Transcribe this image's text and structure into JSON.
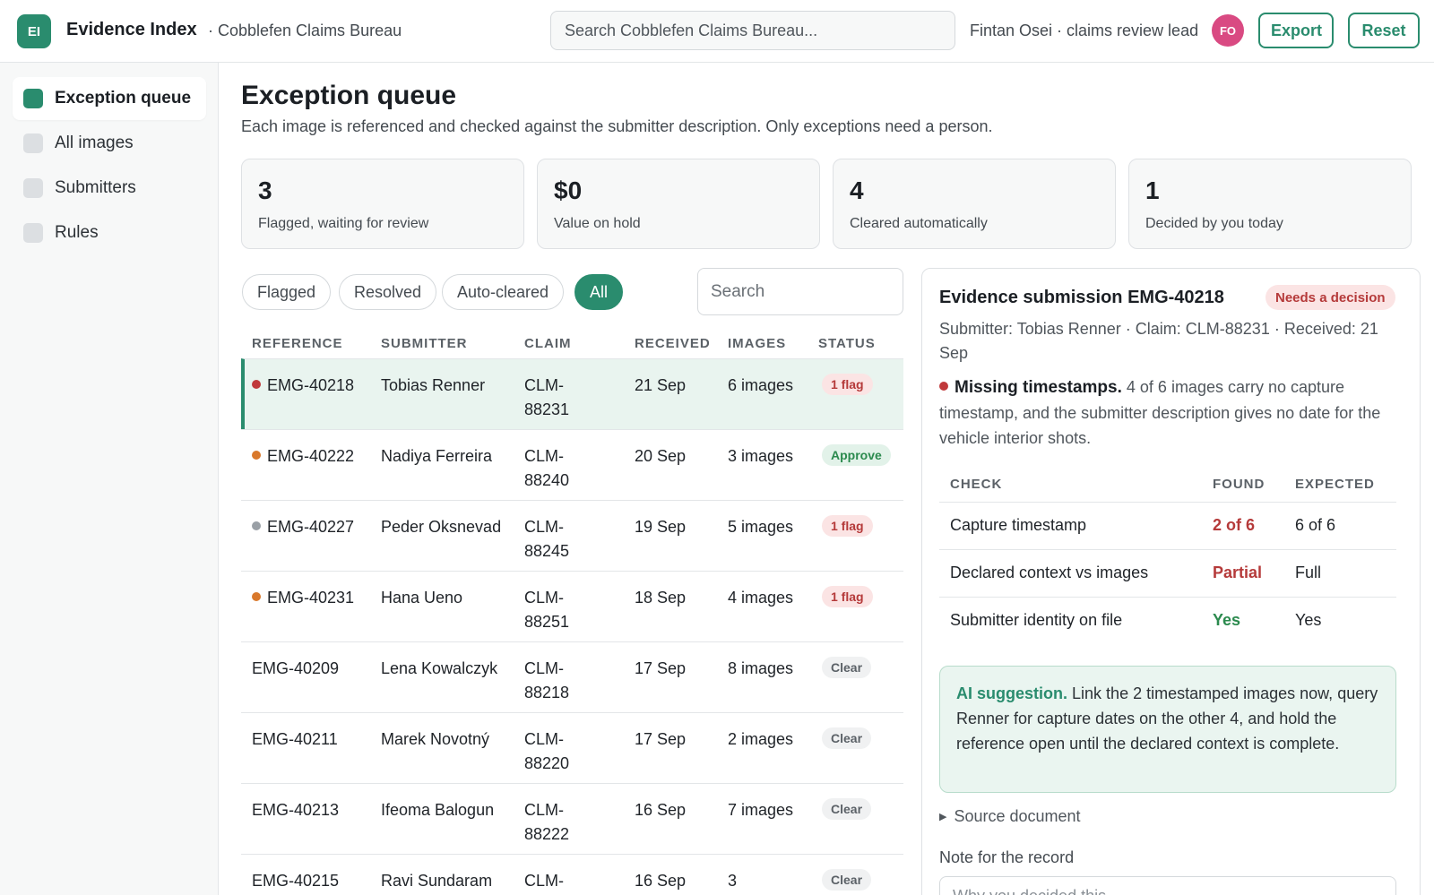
{
  "app": {
    "logo_text": "EI",
    "title": "Evidence Index",
    "org": "· Cobblefen Claims Bureau",
    "search_placeholder": "Search Cobblefen Claims Bureau...",
    "user": "Fintan Osei · claims review lead",
    "avatar": "FO",
    "export_label": "Export",
    "reset_label": "Reset"
  },
  "sidebar": {
    "items": [
      {
        "label": "Exception queue",
        "active": true
      },
      {
        "label": "All images",
        "active": false
      },
      {
        "label": "Submitters",
        "active": false
      },
      {
        "label": "Rules",
        "active": false
      }
    ]
  },
  "page": {
    "title": "Exception queue",
    "subtitle": "Each image is referenced and checked against the submitter description. Only exceptions need a person."
  },
  "stats": [
    {
      "value": "3",
      "label": "Flagged, waiting for review"
    },
    {
      "value": "$0",
      "label": "Value on hold"
    },
    {
      "value": "4",
      "label": "Cleared automatically"
    },
    {
      "value": "1",
      "label": "Decided by you today"
    }
  ],
  "filters": [
    "Flagged",
    "Resolved",
    "Auto-cleared",
    "All"
  ],
  "active_filter": "All",
  "table_search_placeholder": "Search",
  "table": {
    "headers": [
      "REFERENCE",
      "SUBMITTER",
      "CLAIM",
      "RECEIVED",
      "IMAGES",
      "STATUS"
    ],
    "rows": [
      {
        "ref": "EMG-40218",
        "submitter": "Tobias Renner",
        "claim": "CLM-88231",
        "received": "21 Sep",
        "images": "6 images",
        "status": "1 flag",
        "kind": "flag",
        "dot": "#c0393b",
        "selected": true
      },
      {
        "ref": "EMG-40222",
        "submitter": "Nadiya Ferreira",
        "claim": "CLM-88240",
        "received": "20 Sep",
        "images": "3 images",
        "status": "Approve",
        "kind": "approve",
        "dot": "#d9782b",
        "selected": false
      },
      {
        "ref": "EMG-40227",
        "submitter": "Peder Oksnevad",
        "claim": "CLM-88245",
        "received": "19 Sep",
        "images": "5 images",
        "status": "1 flag",
        "kind": "flag",
        "dot": "#9aa0a6",
        "selected": false
      },
      {
        "ref": "EMG-40231",
        "submitter": "Hana Ueno",
        "claim": "CLM-88251",
        "received": "18 Sep",
        "images": "4 images",
        "status": "1 flag",
        "kind": "flag",
        "dot": "#d9782b",
        "selected": false
      },
      {
        "ref": "EMG-40209",
        "submitter": "Lena Kowalczyk",
        "claim": "CLM-88218",
        "received": "17 Sep",
        "images": "8 images",
        "status": "Clear",
        "kind": "clear",
        "dot": "",
        "selected": false
      },
      {
        "ref": "EMG-40211",
        "submitter": "Marek Novotný",
        "claim": "CLM-88220",
        "received": "17 Sep",
        "images": "2 images",
        "status": "Clear",
        "kind": "clear",
        "dot": "",
        "selected": false
      },
      {
        "ref": "EMG-40213",
        "submitter": "Ifeoma Balogun",
        "claim": "CLM-88222",
        "received": "16 Sep",
        "images": "7 images",
        "status": "Clear",
        "kind": "clear",
        "dot": "",
        "selected": false
      },
      {
        "ref": "EMG-40215",
        "submitter": "Ravi Sundaram",
        "claim": "CLM-",
        "received": "16 Sep",
        "images": "3",
        "status": "Clear",
        "kind": "clear",
        "dot": "",
        "selected": false
      }
    ]
  },
  "detail": {
    "title": "Evidence submission EMG-40218",
    "badge": "Needs a decision",
    "meta": "Submitter: Tobias Renner · Claim: CLM-88231 · Received: 21 Sep",
    "finding_title": "Missing timestamps.",
    "finding_text": "4 of 6 images carry no capture timestamp, and the submitter description gives no date for the vehicle interior shots.",
    "finding_dot": "#c0393b",
    "checks_headers": [
      "CHECK",
      "FOUND",
      "EXPECTED"
    ],
    "checks": [
      {
        "check": "Capture timestamp",
        "found": "2 of 6",
        "expected": "6 of 6",
        "ok": false
      },
      {
        "check": "Declared context vs images",
        "found": "Partial",
        "expected": "Full",
        "ok": false
      },
      {
        "check": "Submitter identity on file",
        "found": "Yes",
        "expected": "Yes",
        "ok": true
      }
    ],
    "ai_label": "AI suggestion.",
    "ai_text": "Link the 2 timestamped images now, query Renner for capture dates on the other 4, and hold the reference open until the declared context is complete.",
    "source_label": "Source document",
    "note_label": "Note for the record",
    "note_placeholder": "Why you decided this..."
  }
}
